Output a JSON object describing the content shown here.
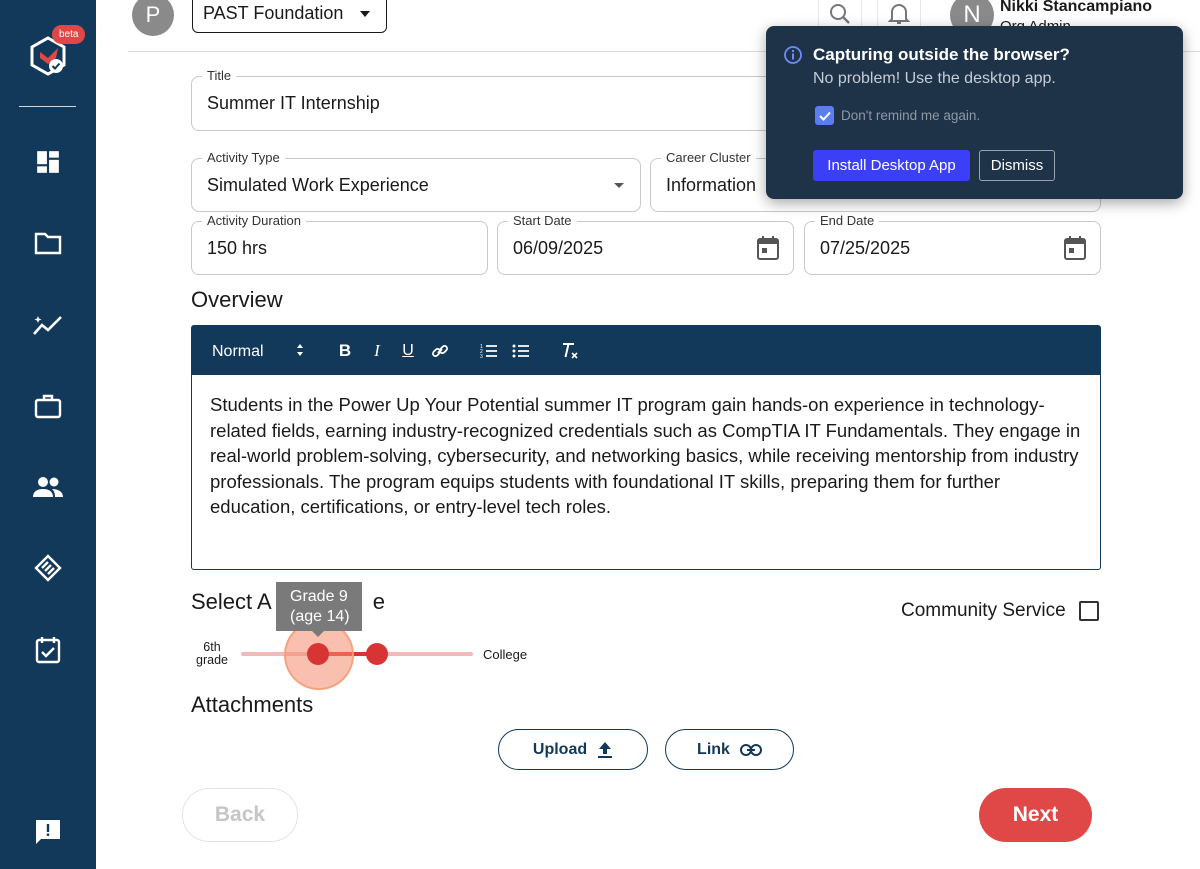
{
  "sidebar": {
    "badge": "beta",
    "items": [
      {
        "icon": "dashboard-icon"
      },
      {
        "icon": "folder-icon"
      },
      {
        "icon": "analytics-icon"
      },
      {
        "icon": "briefcase-icon"
      },
      {
        "icon": "people-icon"
      },
      {
        "icon": "handshake-icon"
      },
      {
        "icon": "calendar-check-icon"
      },
      {
        "icon": "feedback-icon"
      }
    ]
  },
  "header": {
    "org_initial": "P",
    "org_name": "PAST Foundation",
    "user_initial": "N",
    "user_name": "Nikki Stancampiano",
    "user_role": "Org Admin"
  },
  "form": {
    "title_label": "Title",
    "title_value": "Summer IT Internship",
    "activity_type_label": "Activity Type",
    "activity_type_value": "Simulated Work Experience",
    "career_cluster_label": "Career Cluster",
    "career_cluster_value": "Information",
    "duration_label": "Activity Duration",
    "duration_value": "150 hrs",
    "start_label": "Start Date",
    "start_value": "06/09/2025",
    "end_label": "End Date",
    "end_value": "07/25/2025"
  },
  "overview": {
    "heading": "Overview",
    "format_select": "Normal",
    "text": "Students in the Power Up Your Potential summer IT program gain hands-on experience in technology-related fields, earning industry-recognized credentials such as CompTIA IT Fundamentals. They engage in real-world problem-solving, cybersecurity, and networking basics, while receiving mentorship from industry professionals. The program equips students with foundational IT skills, preparing them for further education, certifications, or entry-level tech roles."
  },
  "age_range": {
    "heading_start": "Select A",
    "heading_end": "e",
    "min_label": "6th grade",
    "max_label": "College",
    "tooltip_line1": "Grade 9",
    "tooltip_line2": "(age 14)",
    "community_service_label": "Community Service"
  },
  "attachments": {
    "heading": "Attachments",
    "upload_label": "Upload",
    "link_label": "Link"
  },
  "nav": {
    "back_label": "Back",
    "next_label": "Next"
  },
  "popup": {
    "title": "Capturing outside the browser?",
    "subtitle": "No problem! Use the desktop app.",
    "remind_label": "Don't remind me again.",
    "install_label": "Install Desktop App",
    "dismiss_label": "Dismiss"
  },
  "colors": {
    "sidebar": "#12395a",
    "accent_red": "#e04848",
    "popup_bg": "#1e3248",
    "install_blue": "#3b3ff5"
  }
}
